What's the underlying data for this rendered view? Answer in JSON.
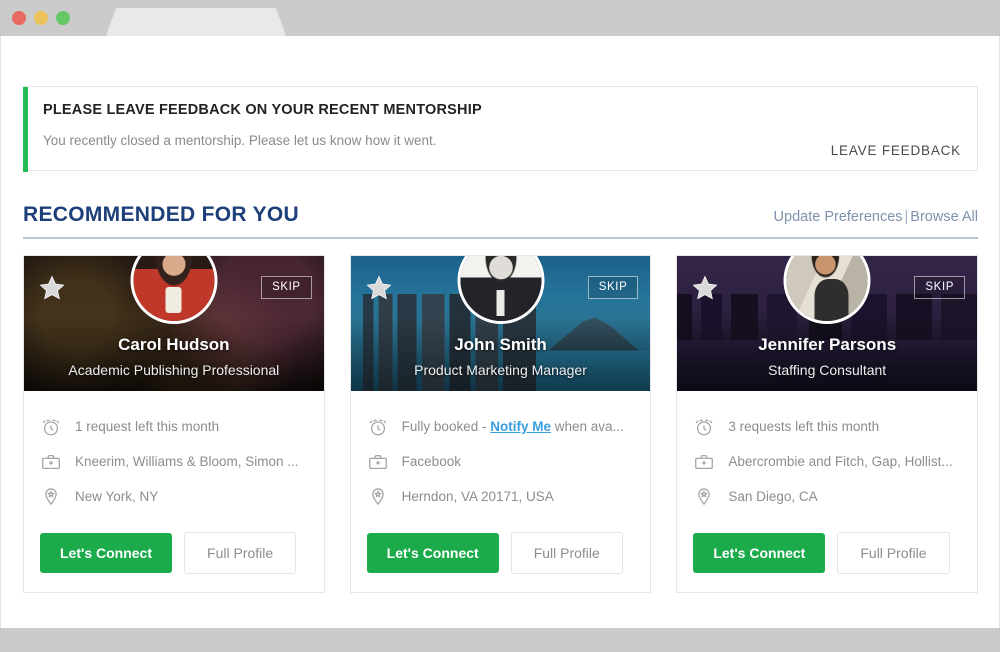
{
  "window": {
    "traffic_lights": [
      "close",
      "minimize",
      "maximize"
    ]
  },
  "banner": {
    "title": "PLEASE LEAVE FEEDBACK ON YOUR RECENT MENTORSHIP",
    "subtitle": "You recently closed a mentorship. Please let us know how it went.",
    "action_label": "LEAVE FEEDBACK",
    "accent_color": "#22bb55"
  },
  "section": {
    "title": "RECOMMENDED FOR YOU",
    "title_color": "#1d3f7a",
    "link_update": "Update Preferences",
    "link_separator": "|",
    "link_browse": "Browse All"
  },
  "cards": [
    {
      "name": "Carol Hudson",
      "role": "Academic Publishing Professional",
      "skip_label": "SKIP",
      "availability": "1 request left this month",
      "availability_link": null,
      "availability_suffix": null,
      "company": "Kneerim, Williams & Bloom, Simon ...",
      "location": "New York, NY",
      "connect_label": "Let's Connect",
      "profile_label": "Full Profile"
    },
    {
      "name": "John Smith",
      "role": "Product Marketing Manager",
      "skip_label": "SKIP",
      "availability": "Fully booked - ",
      "availability_link": "Notify Me",
      "availability_suffix": " when ava...",
      "company": "Facebook",
      "location": "Herndon, VA 20171, USA",
      "connect_label": "Let's Connect",
      "profile_label": "Full Profile"
    },
    {
      "name": "Jennifer Parsons",
      "role": "Staffing Consultant",
      "skip_label": "SKIP",
      "availability": "3 requests left this month",
      "availability_link": null,
      "availability_suffix": null,
      "company": "Abercrombie and Fitch, Gap, Hollist...",
      "location": "San Diego, CA",
      "connect_label": "Let's Connect",
      "profile_label": "Full Profile"
    }
  ],
  "colors": {
    "connect_green": "#1bab4b",
    "link_blue": "#3a9ee0",
    "navy": "#1d3f7a"
  }
}
